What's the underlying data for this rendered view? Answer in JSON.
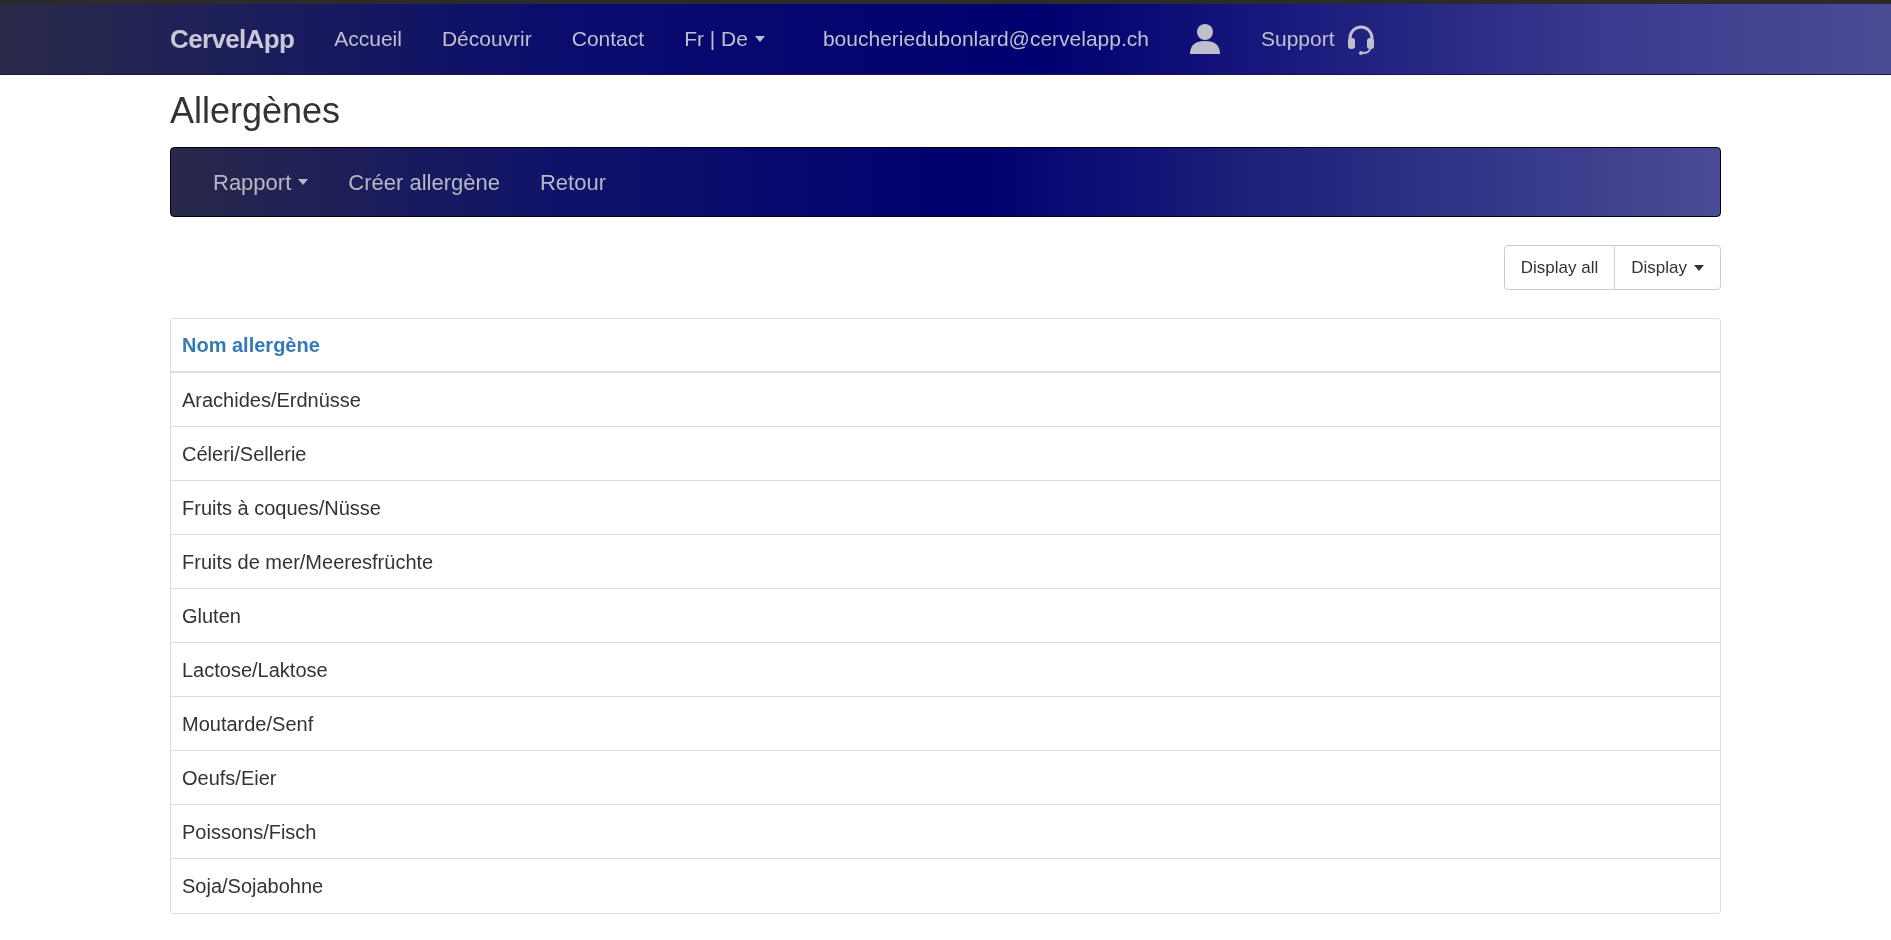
{
  "navbar": {
    "brand": "CervelApp",
    "links": [
      {
        "label": "Accueil",
        "kind": "link"
      },
      {
        "label": "Découvrir",
        "kind": "link"
      },
      {
        "label": "Contact",
        "kind": "link"
      },
      {
        "label": "Fr | De",
        "kind": "dropdown"
      },
      {
        "label": "boucheriedubonlard@cervelapp.ch",
        "kind": "link"
      },
      {
        "kind": "user"
      },
      {
        "label": "Support",
        "kind": "support"
      }
    ]
  },
  "page_title": "Allergènes",
  "subnav": [
    {
      "label": "Rapport",
      "kind": "dropdown"
    },
    {
      "label": "Créer allergène",
      "kind": "link"
    },
    {
      "label": "Retour",
      "kind": "link"
    }
  ],
  "toolbar": [
    {
      "label": "Display all",
      "kind": "button"
    },
    {
      "label": "Display",
      "kind": "dropdown"
    }
  ],
  "table": {
    "columns": [
      "Nom allergène"
    ],
    "rows": [
      [
        "Arachides/Erdnüsse"
      ],
      [
        "Céleri/Sellerie"
      ],
      [
        "Fruits à coques/Nüsse"
      ],
      [
        "Fruits de mer/Meeresfrüchte"
      ],
      [
        "Gluten"
      ],
      [
        "Lactose/Laktose"
      ],
      [
        "Moutarde/Senf"
      ],
      [
        "Oeufs/Eier"
      ],
      [
        "Poissons/Fisch"
      ],
      [
        "Soja/Sojabohne"
      ]
    ]
  }
}
